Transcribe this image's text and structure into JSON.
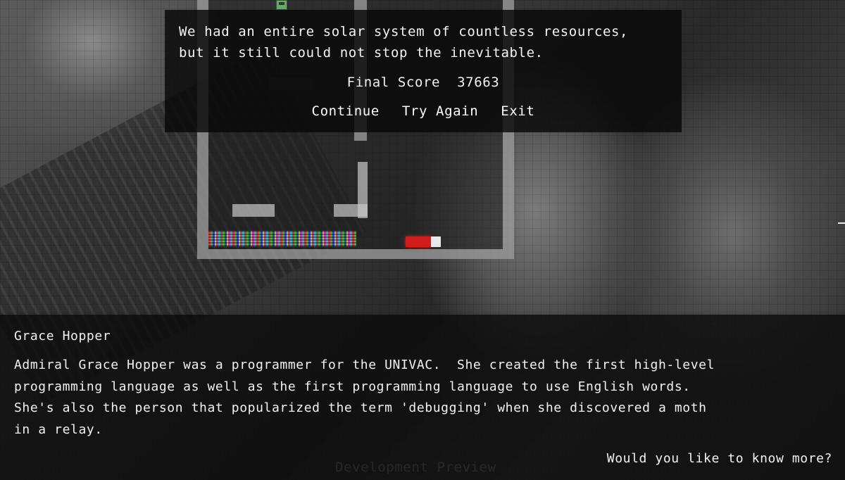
{
  "dialog": {
    "message_line_1": "We had an entire solar system of countless resources,",
    "message_line_2": "but it still could not stop the inevitable.",
    "score_label": "Final Score",
    "score_value": "37663",
    "menu": [
      {
        "label": "Continue"
      },
      {
        "label": "Try Again"
      },
      {
        "label": "Exit"
      }
    ]
  },
  "info": {
    "name": "Grace Hopper",
    "bio_lines": [
      "Admiral Grace Hopper was a programmer for the UNIVAC.  She created the first high-level",
      "programming language as well as the first programming language to use English words.",
      "She's also the person that popularized the term 'debugging' when she discovered a moth",
      "in a relay."
    ],
    "more_link": "Would you like to know more?"
  },
  "watermark": "Development Preview",
  "icons": {
    "save": "floppy-disk-icon"
  },
  "colors": {
    "text": "#f4f4f4",
    "dialog_bg": "#080808",
    "red_piece": "#d21c1c",
    "save_icon": "#6fa36f"
  }
}
